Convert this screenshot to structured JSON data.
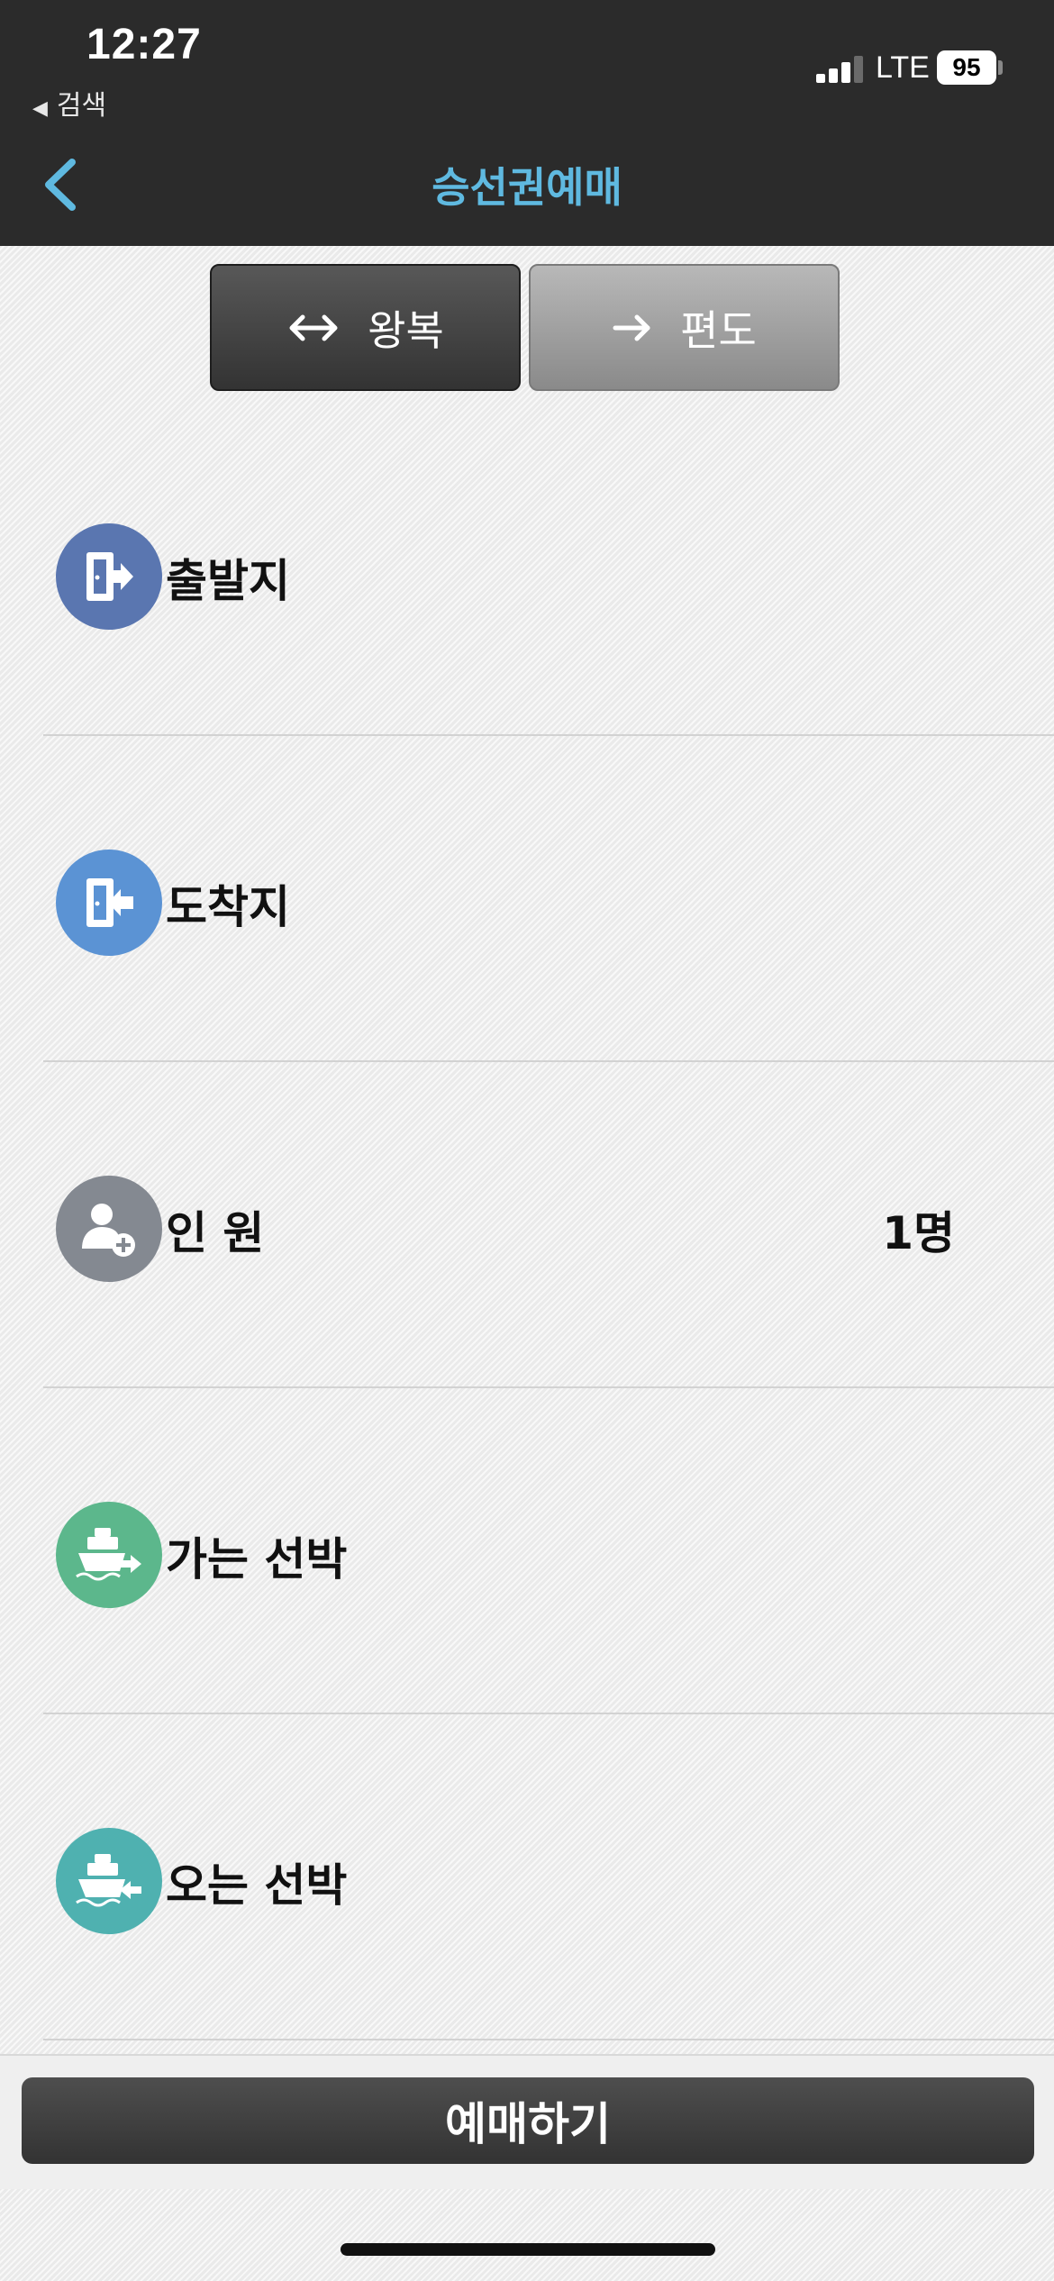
{
  "status_bar": {
    "time": "12:27",
    "back_app": "검색",
    "network": "LTE",
    "battery": "95"
  },
  "header": {
    "title": "승선권예매",
    "back_icon": "chevron-left-icon",
    "accent_color": "#5fb9e0"
  },
  "trip_type": {
    "round_trip": "왕복",
    "one_way": "편도",
    "selected": "왕복"
  },
  "rows": {
    "departure": {
      "label": "출발지",
      "icon": "exit-door-icon",
      "color": "#5a76b0"
    },
    "arrival": {
      "label": "도착지",
      "icon": "enter-door-icon",
      "color": "#5b93d4"
    },
    "passengers": {
      "label": "인 원",
      "value": "1명",
      "icon": "add-person-icon",
      "color": "#848991"
    },
    "outbound_ship": {
      "label": "가는 선박",
      "icon": "ship-outbound-icon",
      "color": "#5cb78c"
    },
    "return_ship": {
      "label": "오는 선박",
      "icon": "ship-return-icon",
      "color": "#4fb1b0"
    }
  },
  "actions": {
    "reserve": "예매하기"
  }
}
